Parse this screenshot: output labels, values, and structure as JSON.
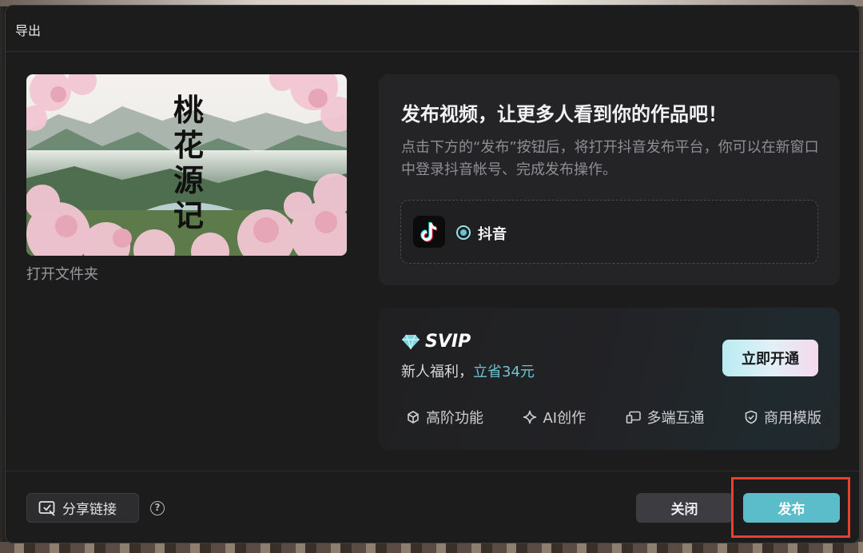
{
  "dialog": {
    "title": "导出"
  },
  "preview": {
    "poster_title_chars": [
      "桃",
      "花",
      "源",
      "记"
    ],
    "open_folder_label": "打开文件夹"
  },
  "publish": {
    "heading": "发布视频，让更多人看到你的作品吧！",
    "description": "点击下方的“发布”按钮后，将打开抖音发布平台，你可以在新窗口中登录抖音帐号、完成发布操作。",
    "platform": {
      "label": "抖音",
      "selected": true,
      "icon": "douyin-logo-icon"
    }
  },
  "svip": {
    "badge": "SVIP",
    "offer_prefix": "新人福利，",
    "offer_highlight": "立省34元",
    "activate_label": "立即开通",
    "features": [
      {
        "label": "高阶功能",
        "icon": "cube-icon"
      },
      {
        "label": "AI创作",
        "icon": "sparkle-icon"
      },
      {
        "label": "多端互通",
        "icon": "devices-icon"
      },
      {
        "label": "商用模版",
        "icon": "shield-check-icon"
      }
    ],
    "colors": {
      "highlight": "#6ec3d0",
      "diamond": "#7fd6e0"
    }
  },
  "footer": {
    "share_label": "分享链接",
    "help_label": "?",
    "close_label": "关闭",
    "publish_label": "发布"
  },
  "colors": {
    "accent": "#5bbdca",
    "annotation_box": "#e5412e",
    "background": "#1c1c1d"
  }
}
